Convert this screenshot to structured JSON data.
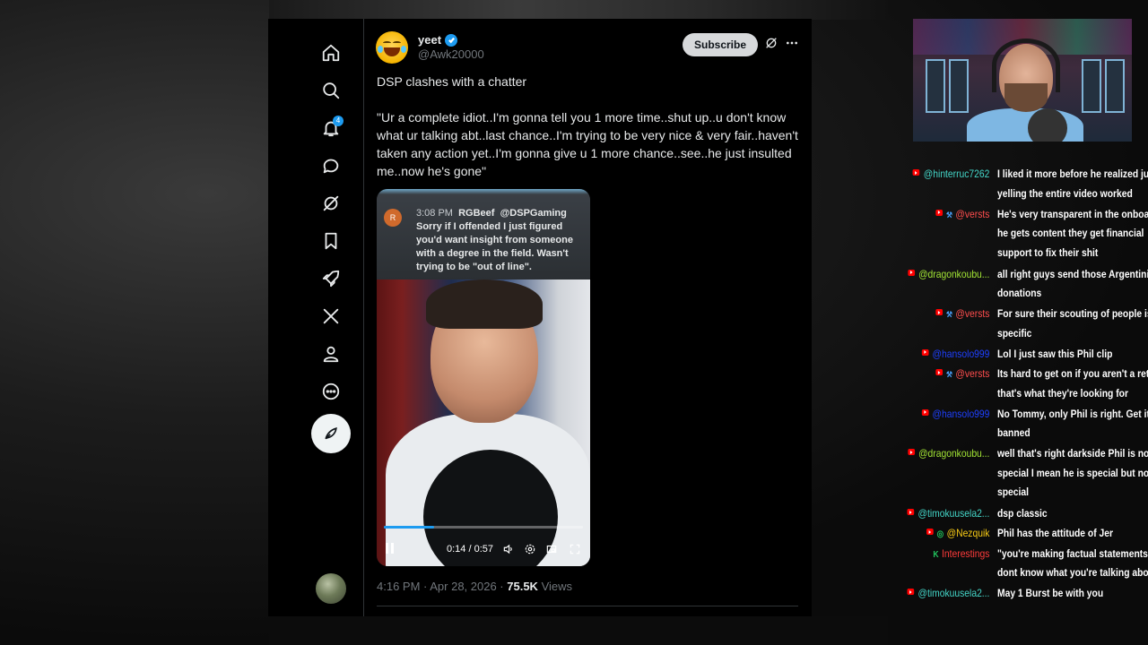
{
  "twitter": {
    "nav": {
      "notif_badge": "4"
    },
    "tweet": {
      "author_name": "yeet",
      "author_handle": "@Awk20000",
      "subscribe_label": "Subscribe",
      "title": "DSP clashes with a chatter",
      "body": "\"Ur a complete idiot..I'm gonna tell you 1 more time..shut up..u don't know what ur talking abt..last chance..I'm trying to be very nice & very fair..haven't taken any action yet..I'm gonna give u 1 more chance..see..he just insulted me..now he's gone\"",
      "video": {
        "caption_avatar_letter": "R",
        "caption_time": "3:08 PM",
        "caption_user": "RGBeef",
        "caption_mention": "@DSPGaming",
        "caption_text": "Sorry if I offended I just figured you'd want insight from someone with a degree in the field. Wasn't trying to be \"out of line\".",
        "time_display": "0:14 / 0:57",
        "progress": 0.25
      },
      "timestamp": "4:16 PM · Apr 28, 2026 · ",
      "views_count": "75.5K",
      "views_label": " Views"
    }
  },
  "chat": {
    "messages": [
      {
        "user": "@hinterruc7262",
        "user_color": "#44d7c9",
        "badges": [
          "yt"
        ],
        "lines": [
          "I liked it more before he realized just",
          "yelling the entire video worked"
        ]
      },
      {
        "user": "@versts",
        "user_color": "#ff4d4d",
        "badges": [
          "yt",
          "tool"
        ],
        "lines": [
          "He's very transparent in the onboarding,",
          "he gets content they get financial",
          "support to fix their shit"
        ]
      },
      {
        "user": "@dragonkoubu...",
        "user_color": "#a3e635",
        "badges": [
          "yt"
        ],
        "lines": [
          "all right guys send those Argentinian",
          "donations"
        ]
      },
      {
        "user": "@versts",
        "user_color": "#ff4d4d",
        "badges": [
          "yt",
          "tool"
        ],
        "lines": [
          "For sure their scouting of people is very",
          "specific"
        ]
      },
      {
        "user": "@hansolo999",
        "user_color": "#1e40ff",
        "badges": [
          "yt"
        ],
        "lines": [
          "Lol I just saw this Phil clip"
        ]
      },
      {
        "user": "@versts",
        "user_color": "#ff4d4d",
        "badges": [
          "yt",
          "tool"
        ],
        "lines": [
          "Its hard to get on if you aren't a retard",
          "that's what they're looking for"
        ]
      },
      {
        "user": "@hansolo999",
        "user_color": "#1e40ff",
        "badges": [
          "yt"
        ],
        "lines": [
          "No Tommy, only Phil is right. Get it? Get",
          "banned"
        ]
      },
      {
        "user": "@dragonkoubu...",
        "user_color": "#a3e635",
        "badges": [
          "yt"
        ],
        "lines": [
          "well that's right darkside Phil is not that",
          "special I mean he is special but not that",
          "special"
        ]
      },
      {
        "user": "@timokuusela2...",
        "user_color": "#44d7c9",
        "badges": [
          "yt"
        ],
        "lines": [
          "dsp classic"
        ]
      },
      {
        "user": "@Nezquik",
        "user_color": "#facc15",
        "badges": [
          "yt",
          "green"
        ],
        "lines": [
          "Phil has the attitude of Jer"
        ]
      },
      {
        "user": "Interestings",
        "user_color": "#ff3b3b",
        "badges": [
          "kick"
        ],
        "lines": [
          "\"you're making factual statements, you",
          "dont know what you're talking about\""
        ]
      },
      {
        "user": "@timokuusela2...",
        "user_color": "#44d7c9",
        "badges": [
          "yt"
        ],
        "lines": [
          "May 1 Burst be with you"
        ]
      }
    ]
  }
}
